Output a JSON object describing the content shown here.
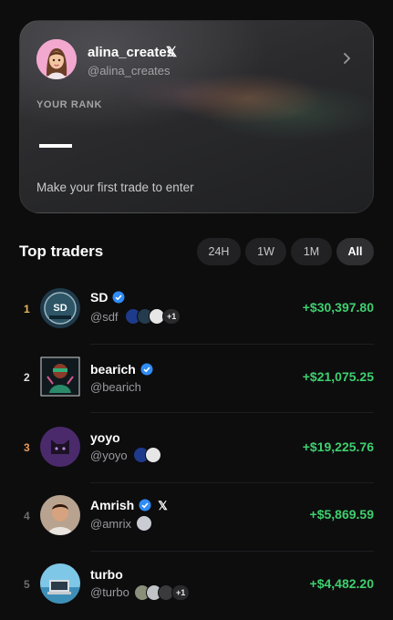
{
  "profile": {
    "username": "alina_creates",
    "handle": "@alina_creates",
    "x_glyph": "𝕏",
    "rank_label": "YOUR RANK",
    "rank_value": "—",
    "cta": "Make your first trade to enter"
  },
  "leaderboard": {
    "title": "Top traders",
    "filters": [
      {
        "label": "24H",
        "selected": false
      },
      {
        "label": "1W",
        "selected": false
      },
      {
        "label": "1M",
        "selected": false
      },
      {
        "label": "All",
        "selected": true
      }
    ],
    "traders": [
      {
        "rank": "1",
        "name": "SD",
        "handle": "@sdf",
        "pnl": "+$30,397.80",
        "verified": true,
        "x_linked": false,
        "more": "+1",
        "rank_color": "#e7b85a"
      },
      {
        "rank": "2",
        "name": "bearich",
        "handle": "@bearich",
        "pnl": "+$21,075.25",
        "verified": true,
        "x_linked": false,
        "more": "",
        "rank_color": "#e0e0e0"
      },
      {
        "rank": "3",
        "name": "yoyo",
        "handle": "@yoyo",
        "pnl": "+$19,225.76",
        "verified": false,
        "x_linked": false,
        "more": "",
        "rank_color": "#e89a5a"
      },
      {
        "rank": "4",
        "name": "Amrish",
        "handle": "@amrix",
        "pnl": "+$5,869.59",
        "verified": true,
        "x_linked": true,
        "more": "",
        "rank_color": "#6d6d70"
      },
      {
        "rank": "5",
        "name": "turbo",
        "handle": "@turbo",
        "pnl": "+$4,482.20",
        "verified": false,
        "x_linked": false,
        "more": "+1",
        "rank_color": "#6d6d70"
      }
    ]
  },
  "colors": {
    "positive": "#3fcf6e",
    "verified": "#2f8cf5",
    "background": "#0d0d0e"
  }
}
